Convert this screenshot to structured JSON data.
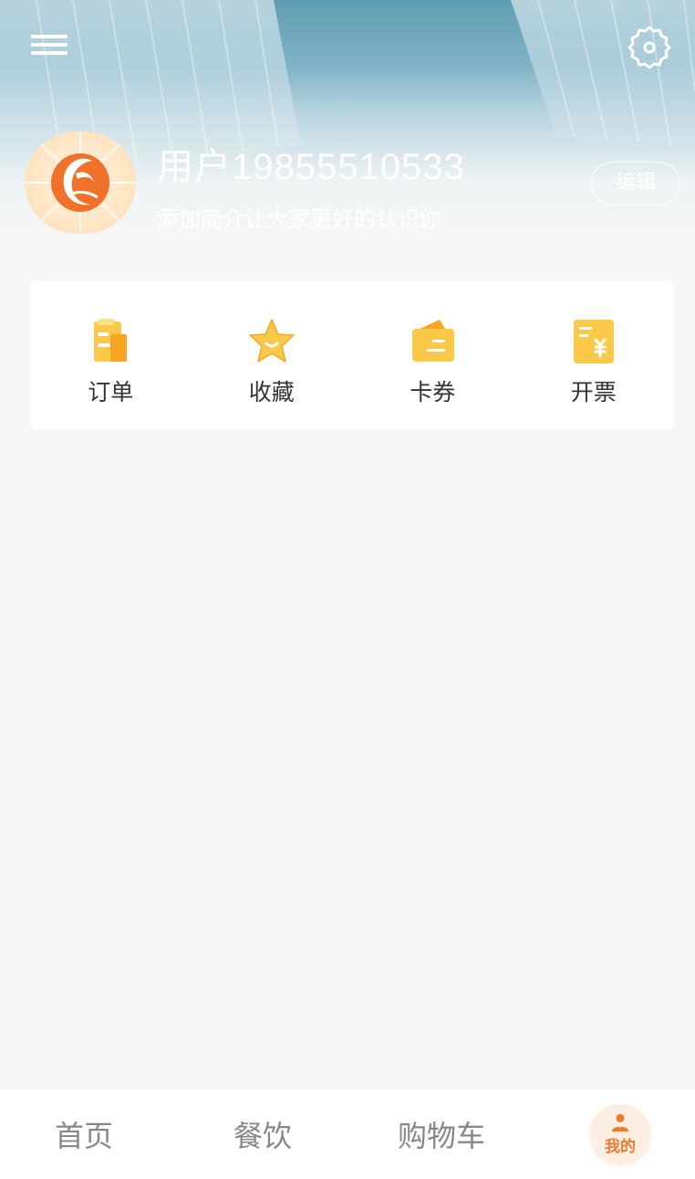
{
  "header": {
    "user_name": "用户19855510533",
    "bio": "添加简介让大家更好的认识你",
    "edit_label": "编辑"
  },
  "quick_actions": [
    {
      "label": "订单",
      "icon": "order-clipboard-icon"
    },
    {
      "label": "收藏",
      "icon": "favorite-star-icon"
    },
    {
      "label": "卡券",
      "icon": "coupon-wallet-icon"
    },
    {
      "label": "开票",
      "icon": "invoice-yen-icon"
    }
  ],
  "tabbar": {
    "home": "首页",
    "food": "餐饮",
    "cart": "购物车",
    "mine": "我的"
  },
  "colors": {
    "accent": "#f07b2c",
    "icon_yellow": "#fbc94a",
    "tab_inactive": "#888888"
  }
}
